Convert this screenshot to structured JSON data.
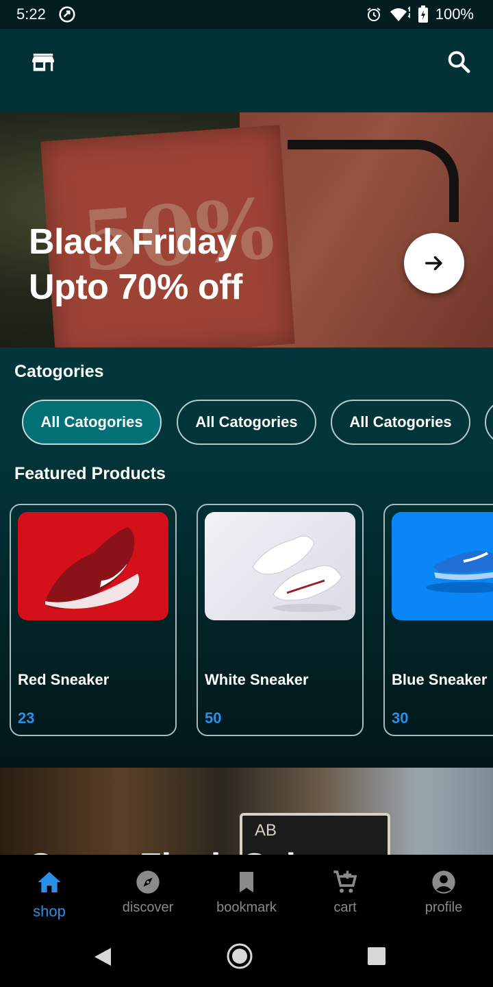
{
  "status": {
    "time": "5:22",
    "battery": "100%",
    "icons": [
      "sync-icon",
      "alarm-icon",
      "wifi-icon",
      "battery-icon"
    ]
  },
  "appbar": {
    "left_icon": "store-icon",
    "right_icon": "search-icon"
  },
  "banner": {
    "title_line1": "Black Friday",
    "title_line2": "Upto 70% off",
    "sign_text": "50%",
    "action_icon": "arrow-right-icon"
  },
  "categories": {
    "title": "Catogories",
    "chips": [
      {
        "label": "All Catogories",
        "selected": true
      },
      {
        "label": "All Catogories",
        "selected": false
      },
      {
        "label": "All Catogories",
        "selected": false
      }
    ]
  },
  "featured": {
    "title": "Featured Products",
    "products": [
      {
        "name": "Red Sneaker",
        "price": "23",
        "color": "#d4101b"
      },
      {
        "name": "White Sneaker",
        "price": "50",
        "color": "#e6e4ee"
      },
      {
        "name": "Blue Sneaker",
        "price": "30",
        "color": "#0a86f5"
      }
    ]
  },
  "flash_banner": {
    "title": "Super Flash Sale",
    "sign_text": "AB"
  },
  "bottom_nav": {
    "items": [
      {
        "label": "shop",
        "icon": "home-icon",
        "active": true
      },
      {
        "label": "discover",
        "icon": "compass-icon",
        "active": false
      },
      {
        "label": "bookmark",
        "icon": "bookmark-icon",
        "active": false
      },
      {
        "label": "cart",
        "icon": "cart-add-icon",
        "active": false
      },
      {
        "label": "profile",
        "icon": "account-circle-icon",
        "active": false
      }
    ]
  },
  "colors": {
    "accent": "#2a8fe6",
    "chip_active": "#037076",
    "appbar": "#023236",
    "status_bar": "#021c1f"
  }
}
